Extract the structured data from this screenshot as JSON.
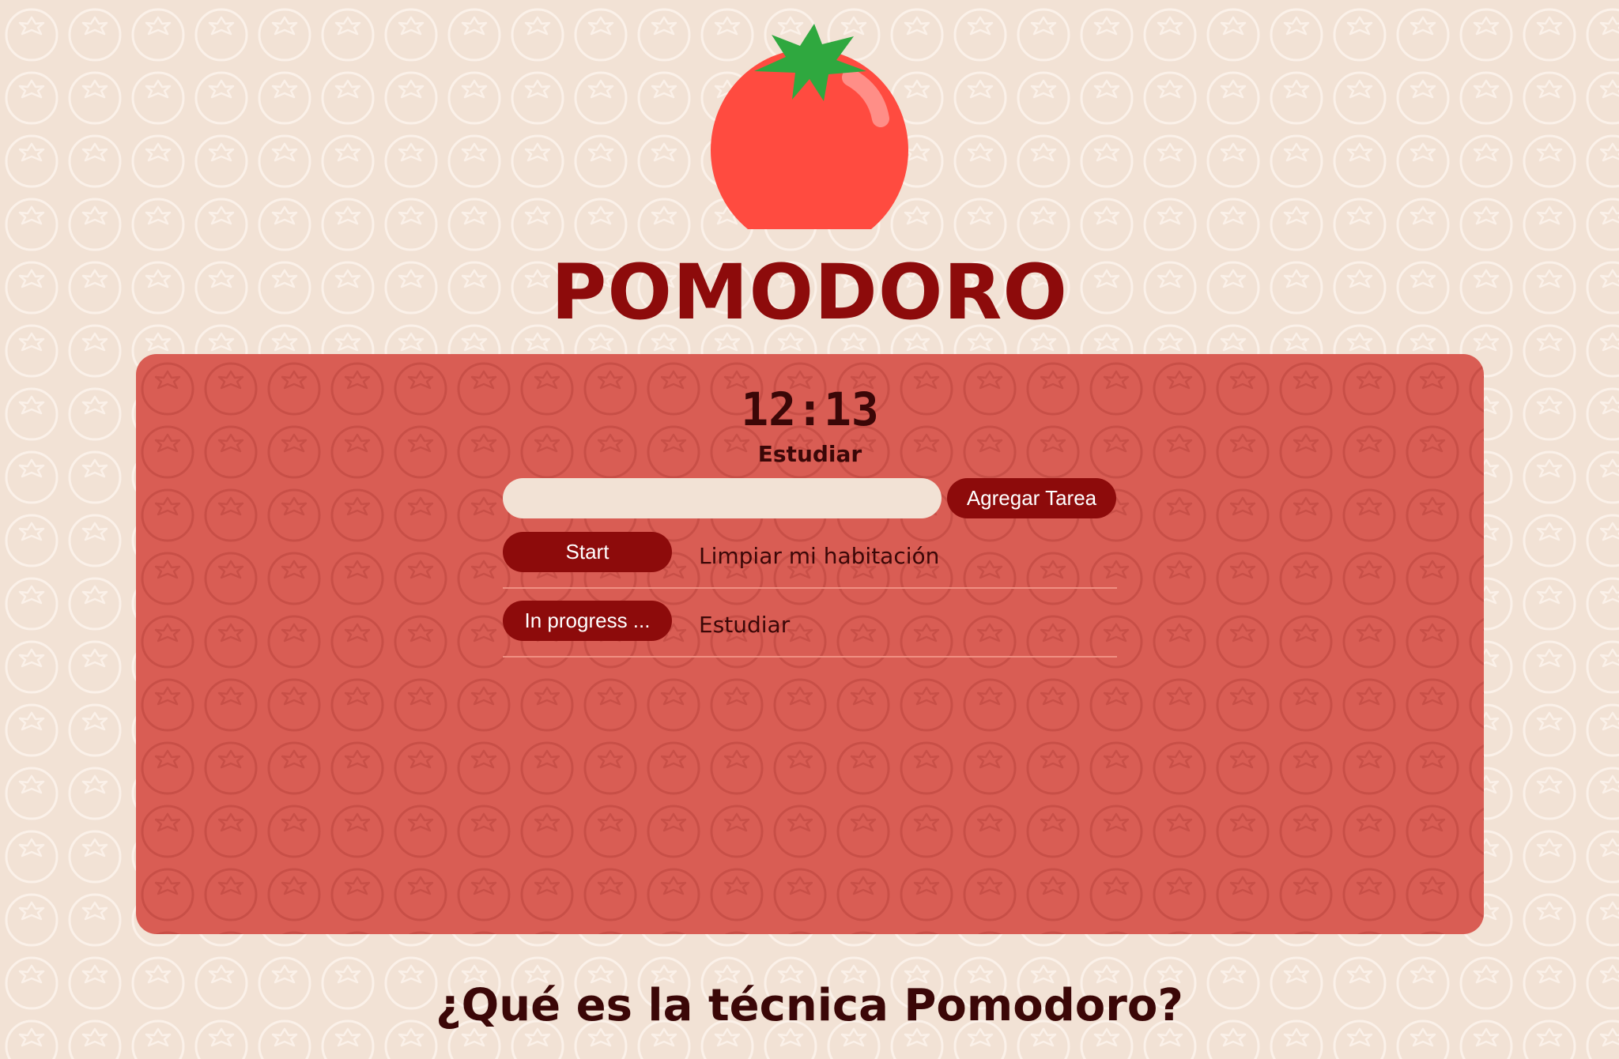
{
  "app": {
    "title": "POMODORO",
    "logo_icon": "tomato-icon"
  },
  "timer": {
    "display": "12:13",
    "mode": "Estudiar"
  },
  "task_form": {
    "input_value": "",
    "input_placeholder": "",
    "add_button_label": "Agregar Tarea"
  },
  "tasks": [
    {
      "button_label": "Start",
      "name": "Limpiar mi habitación"
    },
    {
      "button_label": "In progress ...",
      "name": "Estudiar"
    }
  ],
  "info": {
    "heading": "¿Qué es la técnica Pomodoro?"
  },
  "colors": {
    "background": "#f2e2d5",
    "panel": "#d95d54",
    "accent": "#8d0b0b",
    "text_dark": "#3b0707",
    "divider": "#f08f82"
  }
}
